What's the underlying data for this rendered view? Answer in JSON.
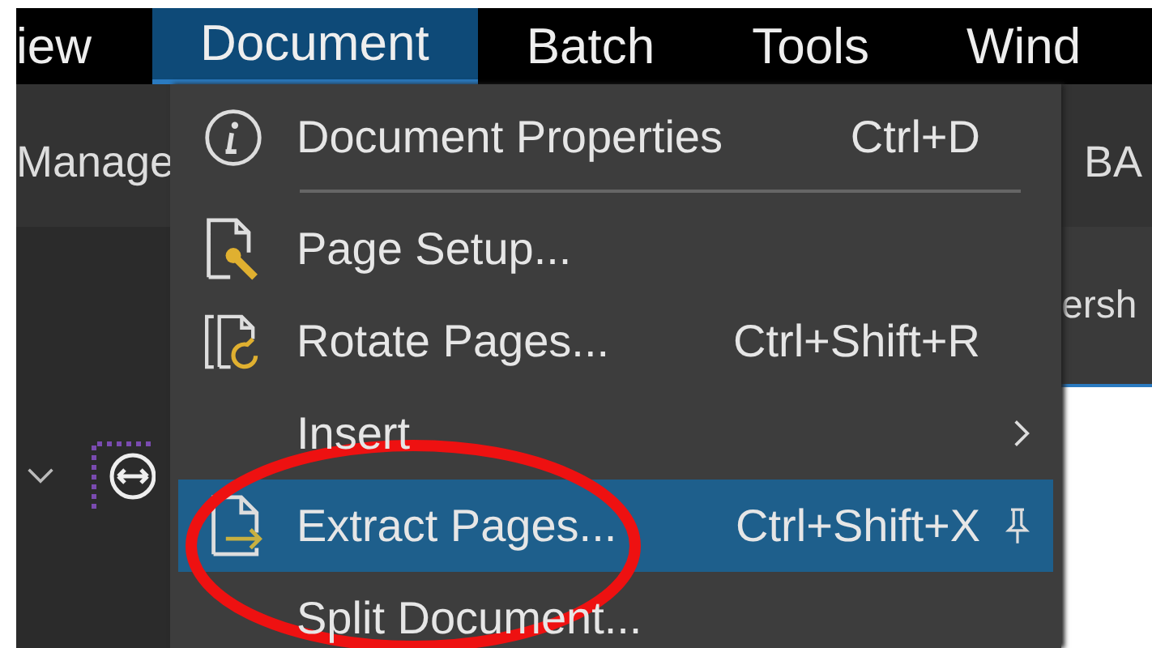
{
  "menubar": [
    {
      "label": "iew",
      "selected": false
    },
    {
      "label": "Document",
      "selected": true
    },
    {
      "label": "Batch",
      "selected": false
    },
    {
      "label": "Tools",
      "selected": false
    },
    {
      "label": "Wind",
      "selected": false
    }
  ],
  "toolbar": {
    "left_label": "Manage",
    "right_label": "BA"
  },
  "tab_label": "ersh",
  "menu": [
    {
      "kind": "info",
      "label": "Document Properties",
      "shortcut": "Ctrl+D",
      "submenu": false,
      "pinned": false,
      "selected": false,
      "separator_after": true
    },
    {
      "kind": "page-setup",
      "label": "Page Setup...",
      "submenu": false,
      "pinned": false,
      "selected": false
    },
    {
      "kind": "rotate",
      "label": "Rotate Pages...",
      "shortcut": "Ctrl+Shift+R",
      "submenu": false,
      "pinned": false,
      "selected": false
    },
    {
      "label": "Insert",
      "submenu": true,
      "pinned": false,
      "selected": false
    },
    {
      "kind": "extract",
      "label": "Extract Pages...",
      "shortcut": "Ctrl+Shift+X",
      "submenu": false,
      "pinned": true,
      "selected": true
    },
    {
      "label": "Split Document...",
      "submenu": false,
      "pinned": false,
      "selected": false
    }
  ]
}
